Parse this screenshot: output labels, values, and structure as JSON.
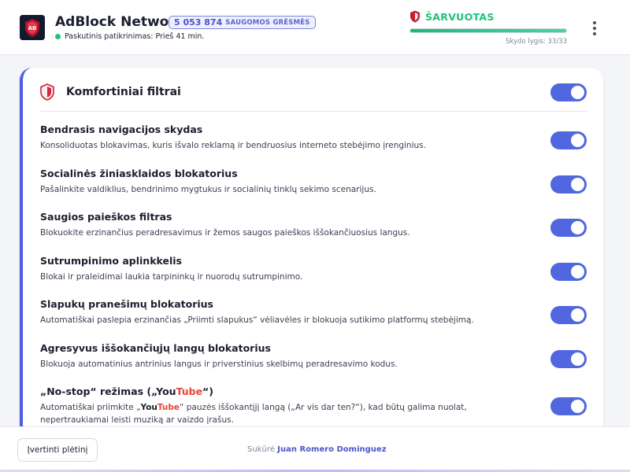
{
  "header": {
    "brand": "AdBlock Network",
    "threats": {
      "count": "5 053 874",
      "label": "SAUGOMOS GRĖSMĖS"
    },
    "last_check": "Paskutinis patikrinimas: Prieš 41 min.",
    "armor": {
      "status": "ŠARVUOTAS",
      "level_text": "Skydo lygis: 33/33",
      "level_fraction": 1.0
    },
    "status_color": "#22c47a",
    "accent_color": "#5067df",
    "icons": {
      "logo": "adblock-logo-icon",
      "shield": "shield-icon",
      "menu": "more-vertical-icon"
    }
  },
  "card": {
    "title": "Komfortiniai filtrai",
    "master_toggle_on": true,
    "filters": [
      {
        "name": "Bendrasis navigacijos skydas",
        "description": "Konsoliduotas blokavimas, kuris išvalo reklamą ir bendruosius interneto stebėjimo įrenginius.",
        "enabled": true
      },
      {
        "name": "Socialinės žiniasklaidos blokatorius",
        "description": "Pašalinkite valdiklius, bendrinimo mygtukus ir socialinių tinklų sekimo scenarijus.",
        "enabled": true
      },
      {
        "name": "Saugios paieškos filtras",
        "description": "Blokuokite erzinančius peradresavimus ir žemos saugos paieškos iššokančiuosius langus.",
        "enabled": true
      },
      {
        "name": "Sutrumpinimo aplinkkelis",
        "description": "Blokai ir praleidimai laukia tarpininkų ir nuorodų sutrumpinimo.",
        "enabled": true
      },
      {
        "name": "Slapukų pranešimų blokatorius",
        "description": "Automatiškai paslepia erzinančias „Priimti slapukus“ vėliavėles ir blokuoja sutikimo platformų stebėjimą.",
        "enabled": true
      },
      {
        "name": "Agresyvus iššokančiųjų langų blokatorius",
        "description": "Blokuoja automatinius antrinius langus ir priverstinius skelbimų peradresavimo kodus.",
        "enabled": true
      }
    ],
    "nostop": {
      "name_prefix": "„No-stop“ režimas („",
      "name_suffix": "“)",
      "yt_a": "You",
      "yt_b": "Tube",
      "desc_prefix": "Automatiškai priimkite „",
      "desc_suffix": "“ pauzės iššokantįjį langą („Ar vis dar ten?“), kad būtų galima nuolat, nepertraukiamai leisti muziką ar vaizdo įrašus.",
      "enabled": true
    }
  },
  "footer": {
    "rate_button": "Įvertinti plėtinį",
    "credit_prefix": "Sukūrė",
    "credit_author": "Juan Romero Dominguez"
  }
}
